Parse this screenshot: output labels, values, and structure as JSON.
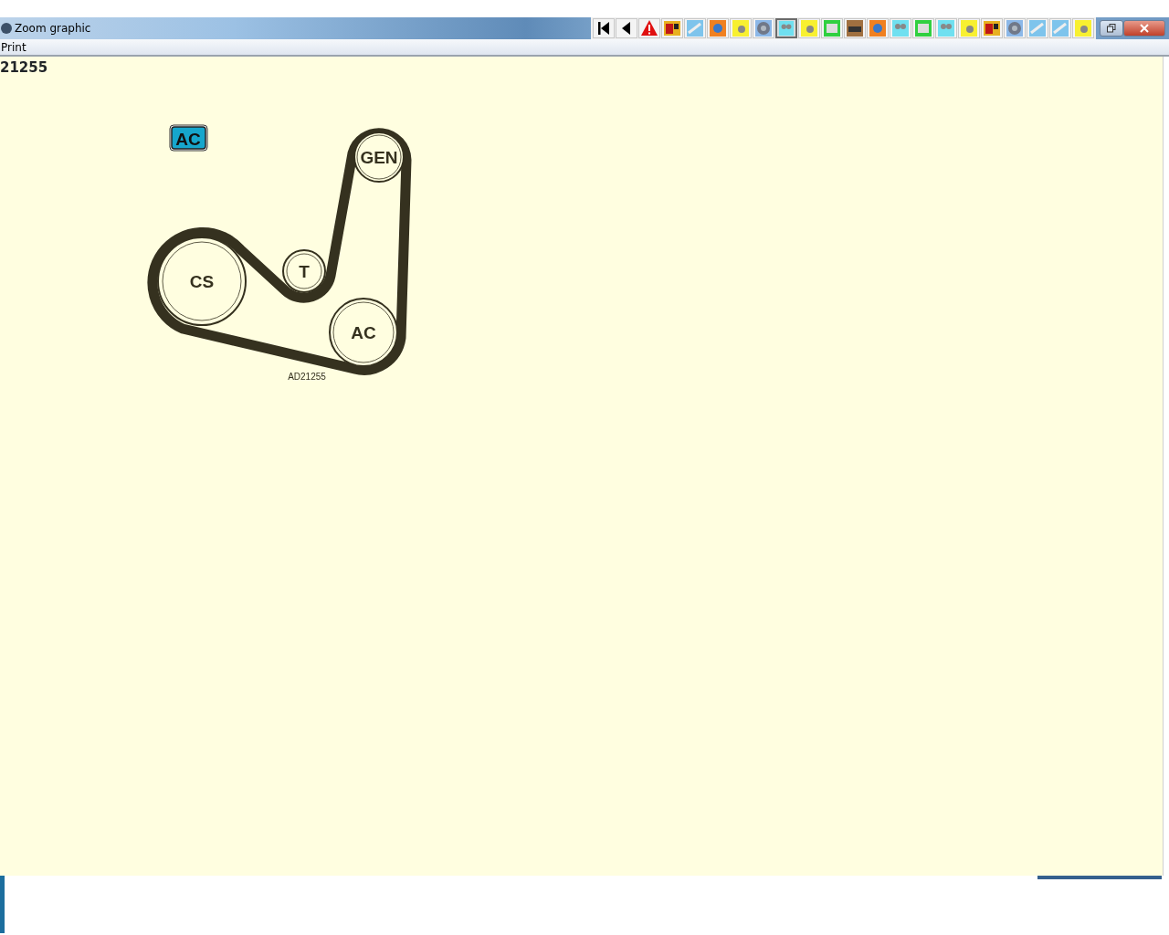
{
  "window": {
    "title": "Zoom graphic"
  },
  "toolbar": [
    {
      "kind": "first",
      "selected": false
    },
    {
      "kind": "prev",
      "selected": false
    },
    {
      "kind": "warning",
      "selected": false
    },
    {
      "kind": "red",
      "selected": false
    },
    {
      "kind": "sky",
      "selected": false
    },
    {
      "kind": "orange",
      "selected": false
    },
    {
      "kind": "yellow",
      "selected": false
    },
    {
      "kind": "disc",
      "selected": false
    },
    {
      "kind": "cyan",
      "selected": true
    },
    {
      "kind": "yellow",
      "selected": false
    },
    {
      "kind": "green",
      "selected": false
    },
    {
      "kind": "brown",
      "selected": false
    },
    {
      "kind": "orange",
      "selected": false
    },
    {
      "kind": "cyan",
      "selected": false
    },
    {
      "kind": "green",
      "selected": false
    },
    {
      "kind": "cyan",
      "selected": false
    },
    {
      "kind": "yellow",
      "selected": false
    },
    {
      "kind": "red",
      "selected": false
    },
    {
      "kind": "disc",
      "selected": false
    },
    {
      "kind": "sky",
      "selected": false
    },
    {
      "kind": "sky",
      "selected": false
    },
    {
      "kind": "yellow",
      "selected": false
    }
  ],
  "menu": [
    "Print"
  ],
  "heading": "21255",
  "diagram": {
    "legend": "AC",
    "pulleys": [
      {
        "label": "GEN"
      },
      {
        "label": "T"
      },
      {
        "label": "CS"
      },
      {
        "label": "AC"
      }
    ],
    "caption": "AD21255"
  }
}
